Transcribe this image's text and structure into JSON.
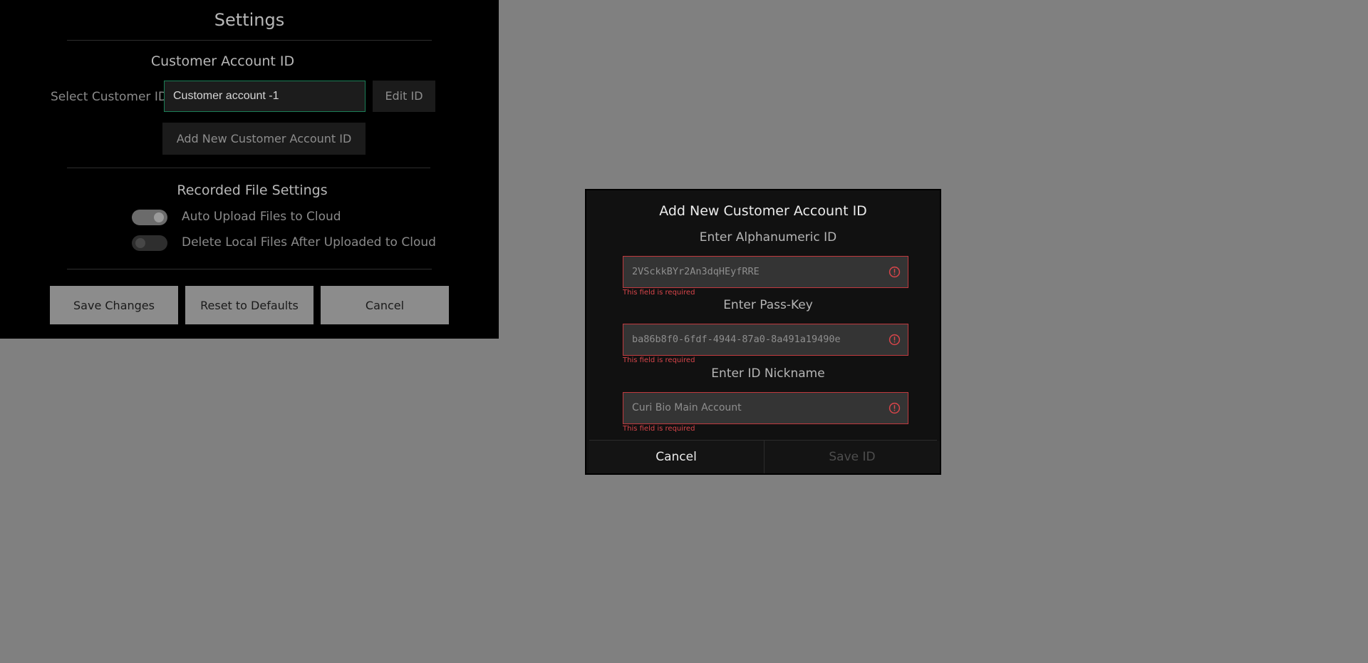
{
  "settings": {
    "title": "Settings",
    "customer_section": {
      "heading": "Customer Account ID",
      "select_label": "Select Customer ID",
      "selected_value": "Customer account -1",
      "edit_button": "Edit ID",
      "add_button": "Add New Customer Account ID"
    },
    "recorded_files": {
      "heading": "Recorded File Settings",
      "auto_upload": {
        "label": "Auto Upload Files to Cloud",
        "enabled": true
      },
      "delete_local": {
        "label": "Delete Local Files After Uploaded to Cloud",
        "enabled": false
      }
    },
    "buttons": {
      "save": "Save Changes",
      "reset": "Reset to Defaults",
      "cancel": "Cancel"
    }
  },
  "modal": {
    "title": "Add New Customer Account ID",
    "fields": [
      {
        "label": "Enter Alphanumeric ID",
        "value": "2VSckkBYr2An3dqHEyfRRE",
        "error": "This field is required",
        "icon": "error-circle-icon"
      },
      {
        "label": "Enter Pass-Key",
        "value": "ba86b8f0-6fdf-4944-87a0-8a491a19490e",
        "error": "This field is required",
        "icon": "error-circle-icon"
      },
      {
        "label": "Enter ID Nickname",
        "value": "Curi Bio Main Account",
        "error": "This field is required",
        "icon": "error-circle-icon"
      }
    ],
    "cancel_button": "Cancel",
    "save_button": "Save ID"
  },
  "colors": {
    "accent_border": "#1b7f57",
    "error": "#d8454a",
    "overlay": "#808080"
  }
}
